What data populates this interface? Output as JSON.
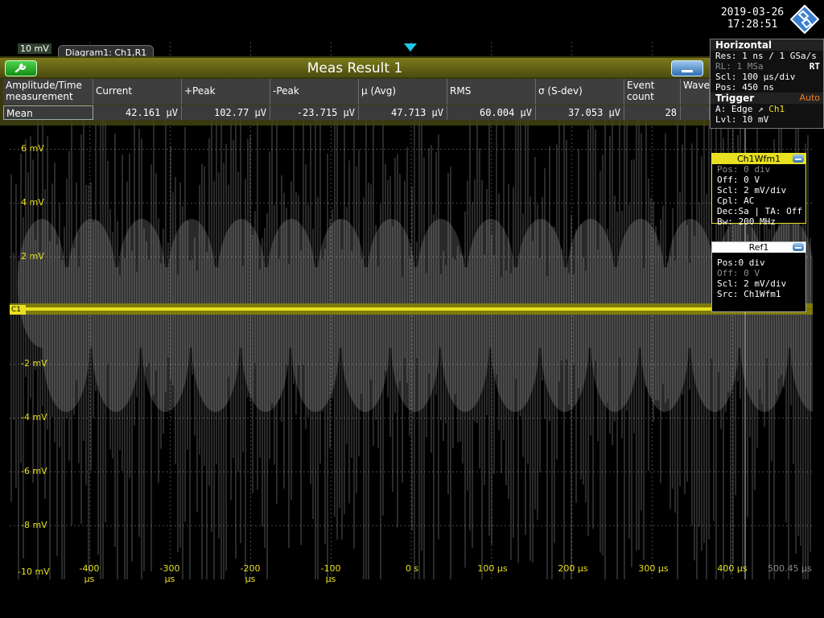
{
  "datetime": {
    "date": "2019-03-26",
    "time": "17:28:51"
  },
  "diagram": {
    "tab": "Diagram1: Ch1,R1",
    "top_scale": "10 mV"
  },
  "y_labels": [
    "6 mV",
    "4 mV",
    "2 mV",
    "-2 mV",
    "-4 mV",
    "-6 mV",
    "-8 mV",
    "-10 mV"
  ],
  "x_labels": [
    "-400 µs",
    "-300 µs",
    "-200 µs",
    "-100 µs",
    "0 s",
    "100 µs",
    "200 µs",
    "300 µs",
    "400 µs"
  ],
  "x_position": "500.45 µs",
  "channel_marker": "C1",
  "meas": {
    "title": "Meas Result 1",
    "headers": [
      "Amplitude/Time measurement",
      "Current",
      "+Peak",
      "-Peak",
      "µ (Avg)",
      "RMS",
      "σ (S-dev)",
      "Event count",
      "Wave count"
    ],
    "row_label": "Mean",
    "values": [
      "42.161 µV",
      "102.77 µV",
      "-23.715 µV",
      "47.713 µV",
      "60.004 µV",
      "37.053 µV",
      "28",
      ""
    ]
  },
  "horizontal": {
    "title": "Horizontal",
    "res": "Res: 1 ns / 1 GSa/s",
    "rl": "RL:  1 MSa",
    "mode": "RT",
    "scl": "Scl: 100 µs/div",
    "pos": "Pos: 450 ns",
    "trigger_title": "Trigger",
    "trigger_mode": "Auto",
    "trig_a": "A:  Edge",
    "trig_src": "Ch1",
    "trig_lvl": "Lvl: 10 mV"
  },
  "ch1": {
    "title": "Ch1Wfm1",
    "pos": "Pos: 0 div",
    "off": "Off: 0 V",
    "scl": "Scl: 2 mV/div",
    "cpl": "Cpl: AC",
    "dec": "Dec:Sa | TA: Off",
    "bw": "Bw: 200 MHz"
  },
  "ref1": {
    "title": "Ref1",
    "pos": "Pos:0 div",
    "off": "Off: 0 V",
    "scl": "Scl: 2 mV/div",
    "src": "Src: Ch1Wfm1"
  },
  "colors": {
    "trace_yellow": "#e8e020",
    "grid": "#4a4a4a",
    "accent_blue": "#2d6fb2"
  }
}
